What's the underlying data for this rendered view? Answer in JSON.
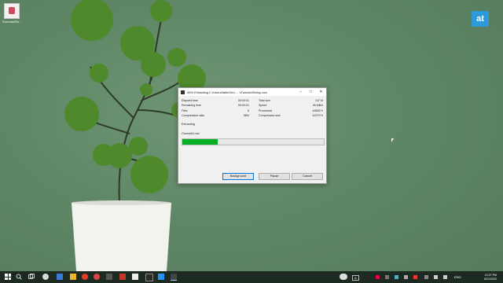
{
  "desktop": {
    "icon_label": "iTunes64Se..."
  },
  "brand": {
    "logo_text": "at",
    "color": "#2c9ad9"
  },
  "window": {
    "title": "45% Extracting C:\\Users\\fatim\\Dro ... \\iTunes64Setup.exe",
    "controls": {
      "minimize": "–",
      "maximize": "□",
      "close": "✕"
    },
    "stats_left": [
      {
        "label": "Elapsed time",
        "value": "00:00:01"
      },
      {
        "label": "Remaining time",
        "value": "00:00:01"
      },
      {
        "label": "Files",
        "value": "6"
      },
      {
        "label": "Compression ratio",
        "value": "98%"
      }
    ],
    "stats_right": [
      {
        "label": "Total size",
        "value": "137 M"
      },
      {
        "label": "Speed",
        "value": "40 MB/s"
      },
      {
        "label": "Processed",
        "value": "63600 K"
      },
      {
        "label": "Compressed size",
        "value": "62379 K"
      }
    ],
    "section_label": "Extracting",
    "current_file": "iTunes64.msi",
    "progress_fraction": 0.25,
    "progress_color": "#06b025",
    "buttons": {
      "background": "Background",
      "pause": "Pause",
      "cancel": "Cancel"
    }
  },
  "taskbar": {
    "icons": [
      "windows-start-icon",
      "search-icon",
      "task-view-icon",
      "app-icon",
      "app-icon",
      "app-icon",
      "app-icon",
      "app-icon",
      "app-icon",
      "app-icon",
      "app-icon",
      "app-icon",
      "app-icon",
      "app-icon",
      "app-icon",
      "app-icon",
      "7zip-icon"
    ],
    "tray": {
      "weather": "A",
      "language": "ENG",
      "time": "10:27 PM",
      "date": "8/21/2020"
    }
  }
}
